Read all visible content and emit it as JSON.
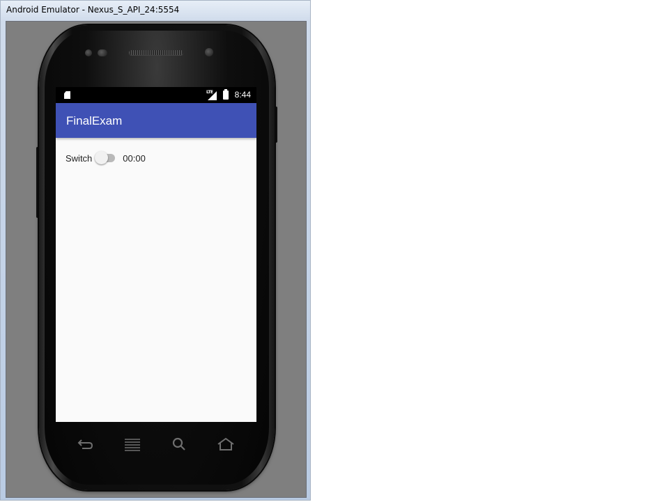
{
  "window": {
    "title": "Android Emulator - Nexus_S_API_24:5554"
  },
  "statusbar": {
    "network_label": "LTE",
    "time": "8:44",
    "icons": [
      "sd-card-icon",
      "signal-icon",
      "battery-icon"
    ]
  },
  "app": {
    "title": "FinalExam",
    "accent_color": "#3f51b5",
    "switch_label": "Switch",
    "switch_on": false,
    "timer_text": "00:00"
  },
  "navkeys": [
    "back-icon",
    "menu-icon",
    "search-icon",
    "home-icon"
  ]
}
